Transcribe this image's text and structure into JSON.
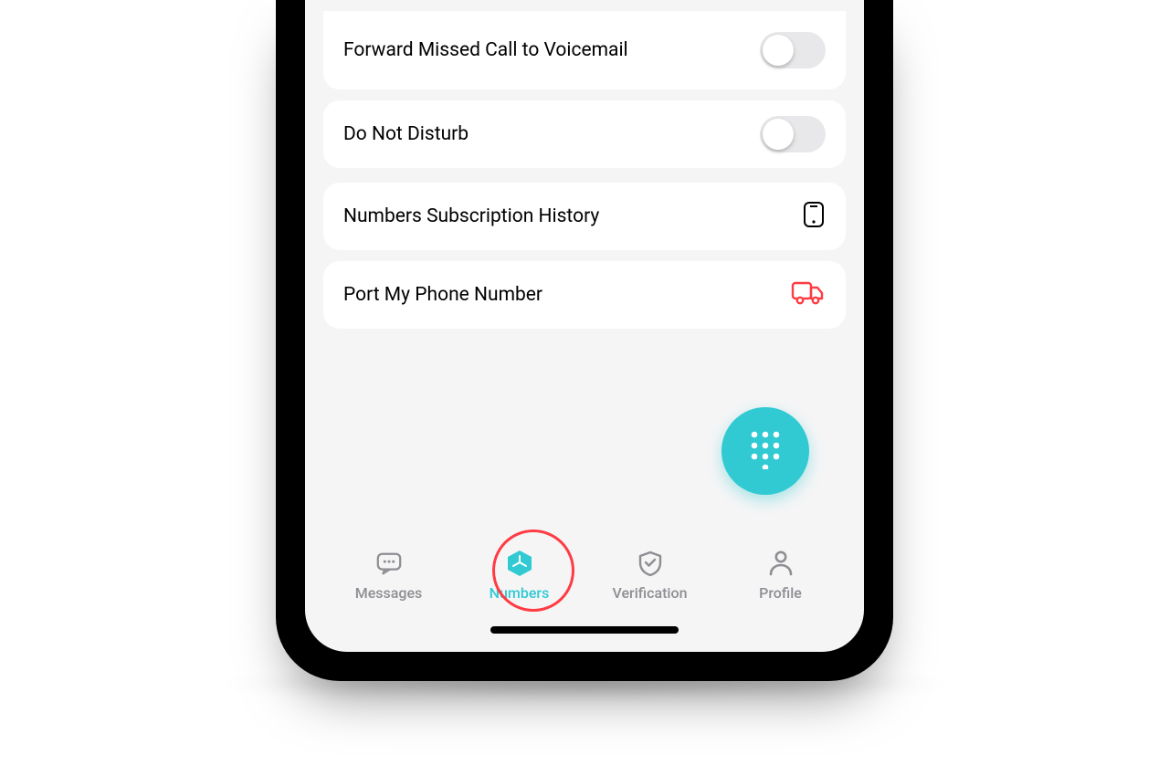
{
  "settings": {
    "forward_missed": {
      "label": "Forward Missed Call to Voicemail",
      "on": false
    },
    "dnd": {
      "label": "Do Not Disturb",
      "on": false
    },
    "history": {
      "label": "Numbers Subscription History"
    },
    "port": {
      "label": "Port My Phone Number"
    }
  },
  "dock": {
    "messages": {
      "label": "Messages"
    },
    "numbers": {
      "label": "Numbers"
    },
    "verification": {
      "label": "Verification"
    },
    "profile": {
      "label": "Profile"
    }
  },
  "colors": {
    "accent": "#31cad3",
    "alert": "#ff3b43"
  }
}
